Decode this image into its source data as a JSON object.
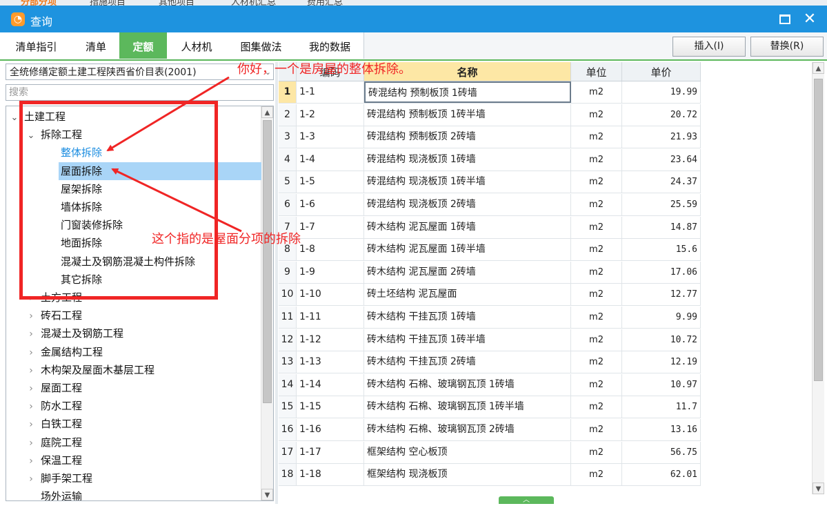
{
  "background_tabs": [
    {
      "label": "分部分项",
      "active": true
    },
    {
      "label": "措施项目",
      "active": false
    },
    {
      "label": "其他项目",
      "active": false
    },
    {
      "label": "人材机汇总",
      "active": false
    },
    {
      "label": "费用汇总",
      "active": false
    }
  ],
  "window": {
    "title": "查询",
    "maximize_label": "",
    "close_label": "✕"
  },
  "tabs": [
    {
      "label": "清单指引",
      "active": false
    },
    {
      "label": "清单",
      "active": false
    },
    {
      "label": "定额",
      "active": true
    },
    {
      "label": "人材机",
      "active": false
    },
    {
      "label": "图集做法",
      "active": false
    },
    {
      "label": "我的数据",
      "active": false
    }
  ],
  "actions": {
    "insert_label": "插入(I)",
    "replace_label": "替换(R)"
  },
  "library": {
    "selected": "全统修缮定额土建工程陕西省价目表(2001)"
  },
  "search": {
    "placeholder": "搜索",
    "value": ""
  },
  "tree": [
    {
      "label": "土建工程",
      "level": 0,
      "toggle": "expanded"
    },
    {
      "label": "拆除工程",
      "level": 1,
      "toggle": "expanded"
    },
    {
      "label": "整体拆除",
      "level": 2,
      "toggle": "none",
      "state": "active"
    },
    {
      "label": "屋面拆除",
      "level": 2,
      "toggle": "none",
      "state": "highlight"
    },
    {
      "label": "屋架拆除",
      "level": 2,
      "toggle": "none"
    },
    {
      "label": "墙体拆除",
      "level": 2,
      "toggle": "none"
    },
    {
      "label": "门窗装修拆除",
      "level": 2,
      "toggle": "none"
    },
    {
      "label": "地面拆除",
      "level": 2,
      "toggle": "none"
    },
    {
      "label": "混凝土及钢筋混凝土构件拆除",
      "level": 2,
      "toggle": "none"
    },
    {
      "label": "其它拆除",
      "level": 2,
      "toggle": "none"
    },
    {
      "label": "土方工程",
      "level": 1,
      "toggle": "collapsed"
    },
    {
      "label": "砖石工程",
      "level": 1,
      "toggle": "collapsed"
    },
    {
      "label": "混凝土及钢筋工程",
      "level": 1,
      "toggle": "collapsed"
    },
    {
      "label": "金属结构工程",
      "level": 1,
      "toggle": "collapsed"
    },
    {
      "label": "木构架及屋面木基层工程",
      "level": 1,
      "toggle": "collapsed"
    },
    {
      "label": "屋面工程",
      "level": 1,
      "toggle": "collapsed"
    },
    {
      "label": "防水工程",
      "level": 1,
      "toggle": "collapsed"
    },
    {
      "label": "白铁工程",
      "level": 1,
      "toggle": "collapsed"
    },
    {
      "label": "庭院工程",
      "level": 1,
      "toggle": "collapsed"
    },
    {
      "label": "保温工程",
      "level": 1,
      "toggle": "collapsed"
    },
    {
      "label": "脚手架工程",
      "level": 1,
      "toggle": "collapsed"
    },
    {
      "label": "场外运输",
      "level": 1,
      "toggle": "none"
    }
  ],
  "grid": {
    "columns": {
      "code": "编码",
      "name": "名称",
      "unit": "单位",
      "price": "单价"
    },
    "rows": [
      {
        "num": "1",
        "code": "1-1",
        "name": "砖混结构 预制板顶 1砖墙",
        "unit": "m2",
        "price": "19.99"
      },
      {
        "num": "2",
        "code": "1-2",
        "name": "砖混结构 预制板顶 1砖半墙",
        "unit": "m2",
        "price": "20.72"
      },
      {
        "num": "3",
        "code": "1-3",
        "name": "砖混结构 预制板顶 2砖墙",
        "unit": "m2",
        "price": "21.93"
      },
      {
        "num": "4",
        "code": "1-4",
        "name": "砖混结构 现浇板顶 1砖墙",
        "unit": "m2",
        "price": "23.64"
      },
      {
        "num": "5",
        "code": "1-5",
        "name": "砖混结构 现浇板顶 1砖半墙",
        "unit": "m2",
        "price": "24.37"
      },
      {
        "num": "6",
        "code": "1-6",
        "name": "砖混结构 现浇板顶 2砖墙",
        "unit": "m2",
        "price": "25.59"
      },
      {
        "num": "7",
        "code": "1-7",
        "name": "砖木结构 泥瓦屋面 1砖墙",
        "unit": "m2",
        "price": "14.87"
      },
      {
        "num": "8",
        "code": "1-8",
        "name": "砖木结构 泥瓦屋面 1砖半墙",
        "unit": "m2",
        "price": "15.6"
      },
      {
        "num": "9",
        "code": "1-9",
        "name": "砖木结构 泥瓦屋面 2砖墙",
        "unit": "m2",
        "price": "17.06"
      },
      {
        "num": "10",
        "code": "1-10",
        "name": "砖土坯结构 泥瓦屋面",
        "unit": "m2",
        "price": "12.77"
      },
      {
        "num": "11",
        "code": "1-11",
        "name": "砖木结构 干挂瓦顶 1砖墙",
        "unit": "m2",
        "price": "9.99"
      },
      {
        "num": "12",
        "code": "1-12",
        "name": "砖木结构 干挂瓦顶 1砖半墙",
        "unit": "m2",
        "price": "10.72"
      },
      {
        "num": "13",
        "code": "1-13",
        "name": "砖木结构 干挂瓦顶 2砖墙",
        "unit": "m2",
        "price": "12.19"
      },
      {
        "num": "14",
        "code": "1-14",
        "name": "砖木结构 石棉、玻璃钢瓦顶 1砖墙",
        "unit": "m2",
        "price": "10.97"
      },
      {
        "num": "15",
        "code": "1-15",
        "name": "砖木结构 石棉、玻璃钢瓦顶 1砖半墙",
        "unit": "m2",
        "price": "11.7"
      },
      {
        "num": "16",
        "code": "1-16",
        "name": "砖木结构 石棉、玻璃钢瓦顶 2砖墙",
        "unit": "m2",
        "price": "13.16"
      },
      {
        "num": "17",
        "code": "1-17",
        "name": "框架结构 空心板顶",
        "unit": "m2",
        "price": "56.75"
      },
      {
        "num": "18",
        "code": "1-18",
        "name": "框架结构 现浇板顶",
        "unit": "m2",
        "price": "62.01"
      }
    ]
  },
  "annotations": {
    "top_note": "你好，一个是房屋的整体拆除。",
    "mid_note": "这个指的是屋面分项的拆除"
  },
  "colors": {
    "titlebar": "#1e93df",
    "tab_active": "#5cb85c",
    "tree_highlight": "#a9d5f7",
    "tree_active_text": "#1a8ce0",
    "annotation_red": "#f02525",
    "name_header": "#fde7a5"
  },
  "icons": {
    "app": "app-logo-icon",
    "maximize": "maximize-icon",
    "close": "close-icon",
    "expand": "chevron-down-icon",
    "collapsed": "chevron-right-icon"
  }
}
